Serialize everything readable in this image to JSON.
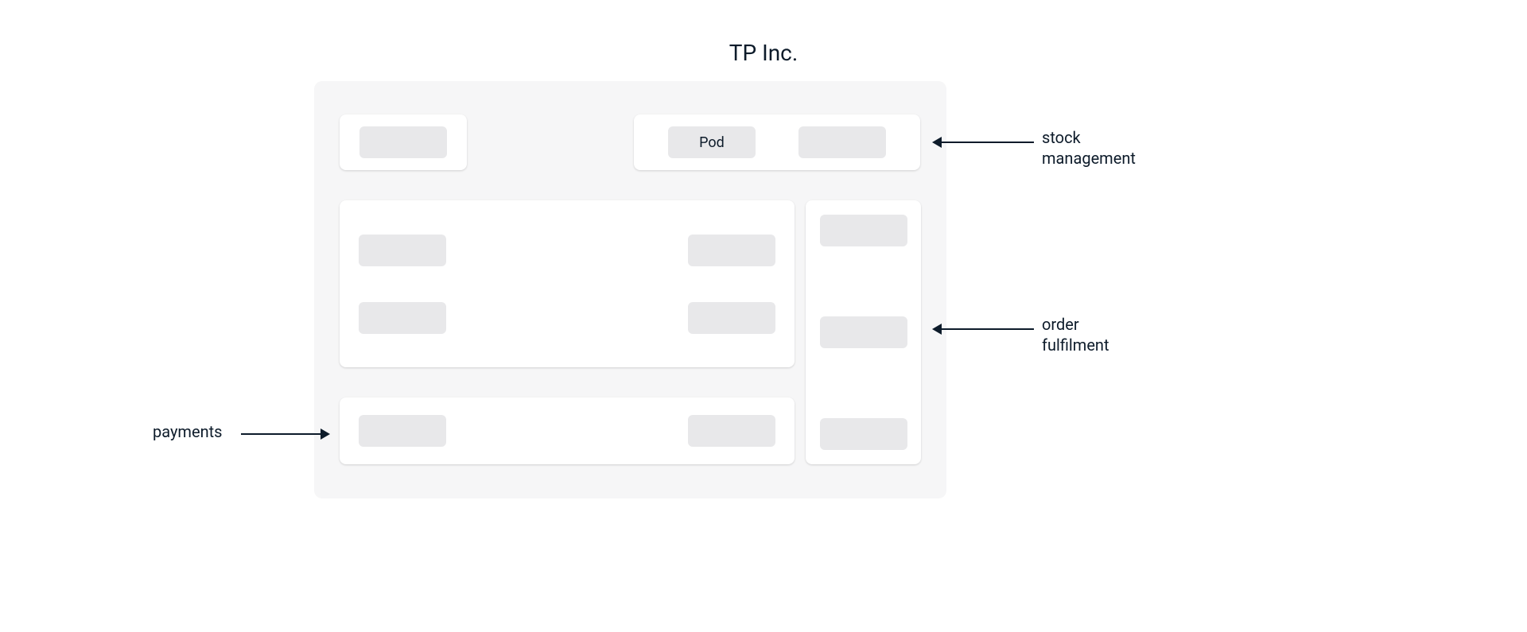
{
  "title": "TP Inc.",
  "pod_label": "Pod",
  "annotations": {
    "stock": "stock\nmanagement",
    "fulfilment": "order\nfulfilment",
    "payments": "payments"
  }
}
